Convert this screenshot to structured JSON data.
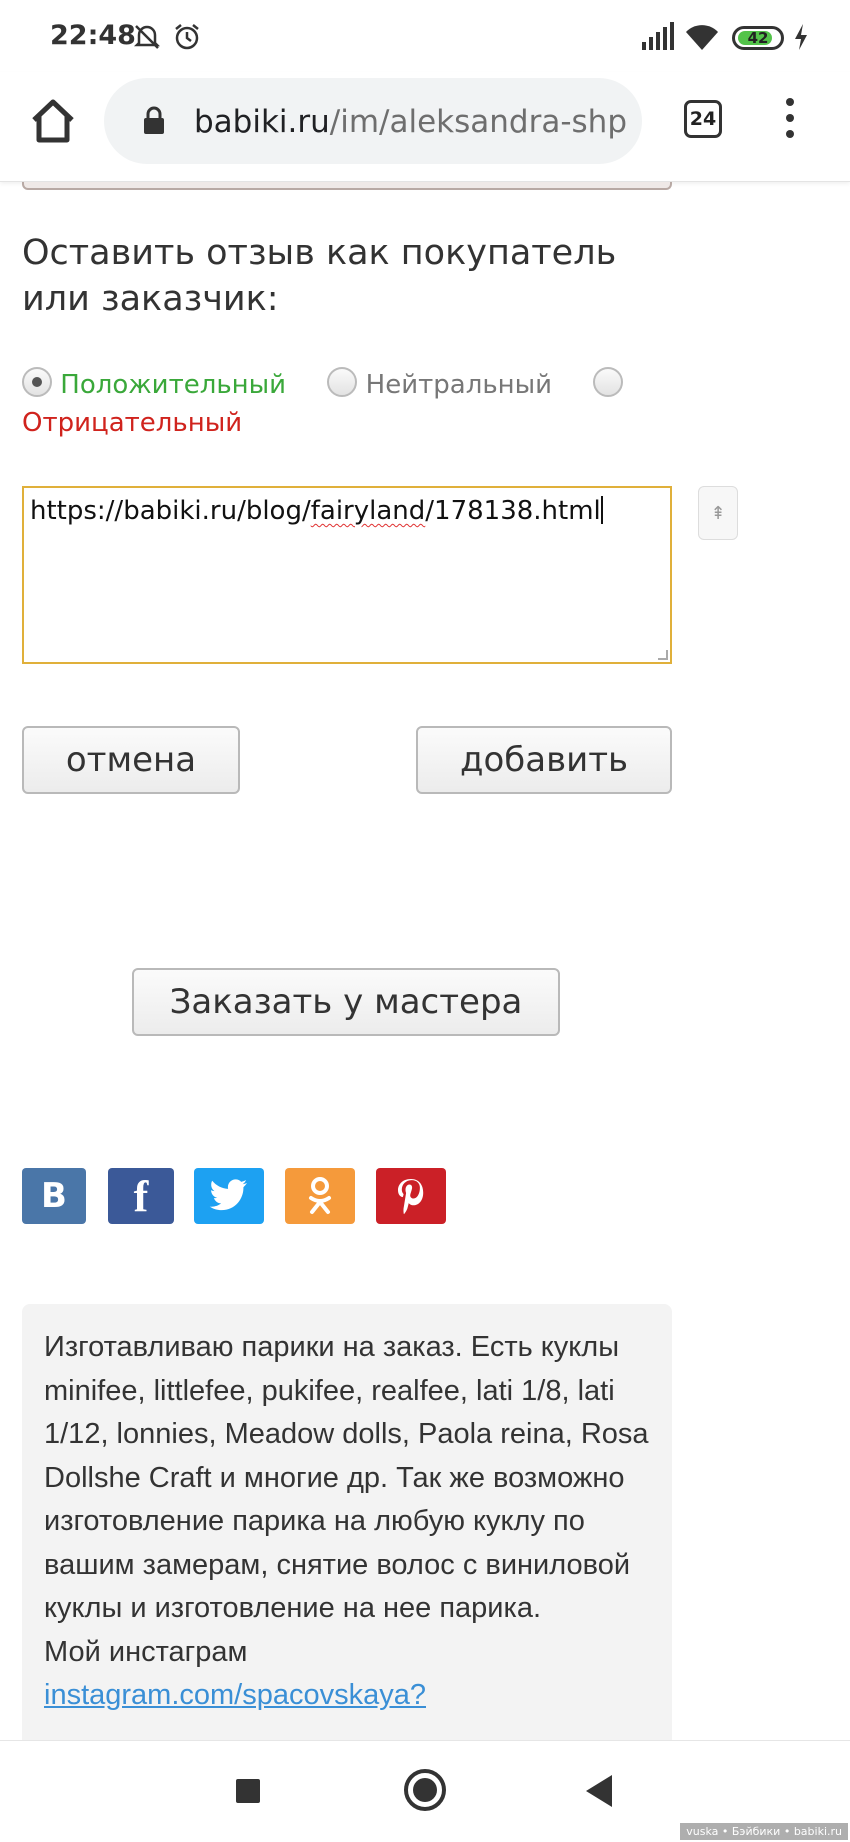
{
  "status_bar": {
    "time": "22:48",
    "battery": "42",
    "icons": [
      "mute-icon",
      "alarm-icon",
      "signal-icon",
      "wifi-icon",
      "battery-icon",
      "charging-icon"
    ]
  },
  "browser": {
    "url_domain": "babiki.ru",
    "url_path": "/im/aleksandra-shp",
    "tab_count": "24"
  },
  "review": {
    "heading": "Оставить отзыв как покупатель или заказчик:",
    "options": {
      "positive": "Положительный",
      "neutral": "Нейтральный",
      "negative": "Отрицательный"
    },
    "selected": "positive",
    "text_before": "https://babiki.ru/blog/",
    "text_spell": "fairyland",
    "text_after": "/178138.html",
    "cancel_label": "отмена",
    "add_label": "добавить"
  },
  "order_label": "Заказать у мастера",
  "social": [
    "vk",
    "facebook",
    "twitter",
    "odnoklassniki",
    "pinterest"
  ],
  "info": {
    "text": "Изготавливаю парики на заказ. Есть куклы minifee, littlefee, pukifee, realfee, lati 1/8, lati 1/12, lonnies, Meadow dolls, Paola reina, Rosa Dollshe Craft и многие др. Так же возможно изготовление парика на любую куклу по вашим замерам, снятие волос с виниловой куклы и изготовление на нее парика.",
    "instagram_label": "Мой инстаграм",
    "instagram_link": "instagram.com/spacovskaya?"
  },
  "watermark": "vuska • Бэйбики • babiki.ru",
  "colors": {
    "positive": "#3aa83a",
    "negative": "#d0231d",
    "focus_border": "#e0b03a",
    "link": "#3a8fd6"
  }
}
